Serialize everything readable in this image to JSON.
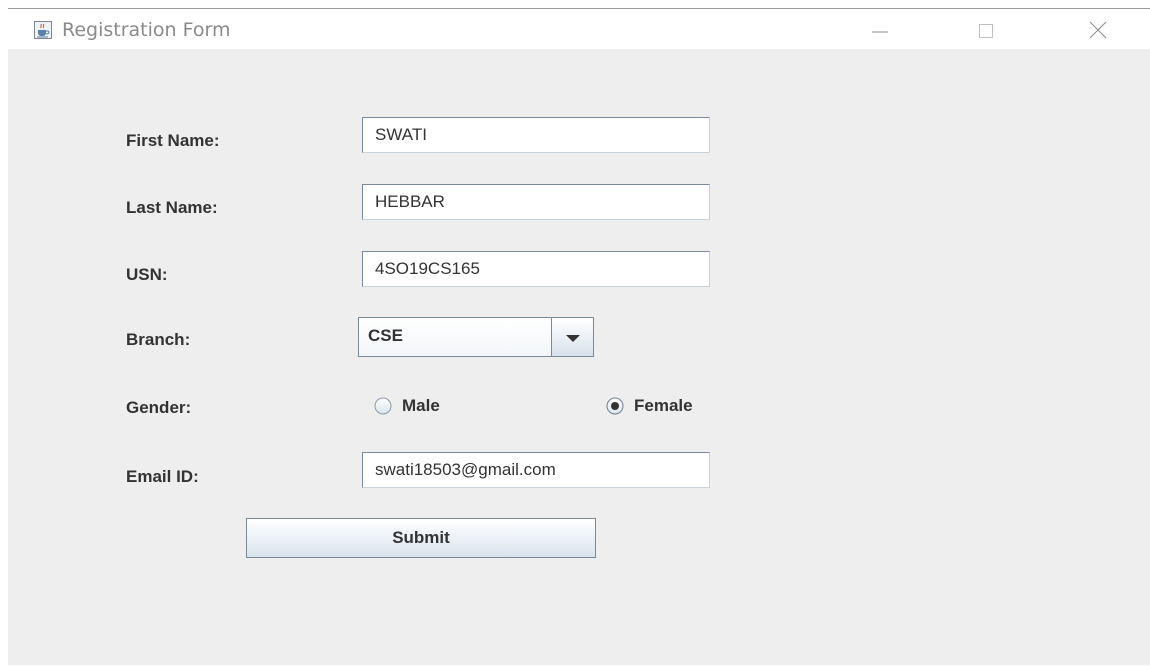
{
  "window": {
    "title": "Registration Form",
    "app_icon": "java-cup-icon",
    "controls": [
      "minimize-icon",
      "maximize-icon",
      "close-icon"
    ]
  },
  "form": {
    "first_name": {
      "label": "First Name:",
      "value": "SWATI"
    },
    "last_name": {
      "label": "Last Name:",
      "value": "HEBBAR"
    },
    "usn": {
      "label": "USN:",
      "value": "4SO19CS165"
    },
    "branch": {
      "label": "Branch:",
      "selected": "CSE"
    },
    "gender": {
      "label": "Gender:",
      "options": [
        {
          "label": "Male",
          "selected": false
        },
        {
          "label": "Female",
          "selected": true
        }
      ]
    },
    "email": {
      "label": "Email ID:",
      "value": "swati18503@gmail.com"
    },
    "submit_label": "Submit"
  },
  "colors": {
    "window_bg": "#eeeeee",
    "text": "#333333",
    "field_border": "#7a8a99",
    "title_text": "#8a8a8a"
  }
}
